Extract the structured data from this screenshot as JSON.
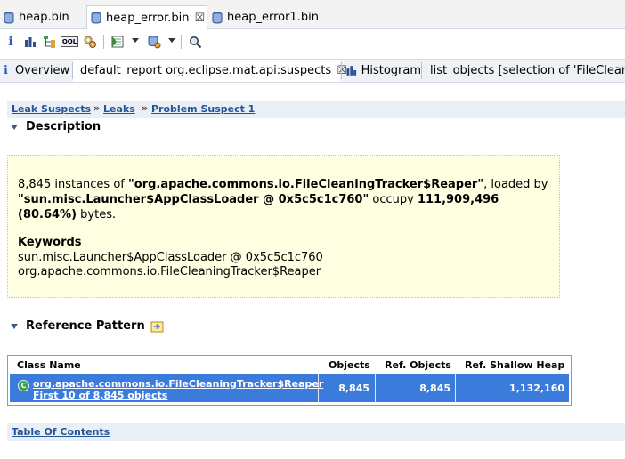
{
  "editor_tabs": [
    {
      "label": "heap.bin"
    },
    {
      "label": "heap_error.bin",
      "close": "☒"
    },
    {
      "label": "heap_error1.bin"
    }
  ],
  "view_tabs": [
    {
      "label": "Overview"
    },
    {
      "label": "default_report  org.eclipse.mat.api:suspects",
      "close": "☒"
    },
    {
      "label": "Histogram"
    },
    {
      "label": "list_objects  [selection of 'FileCleanin"
    }
  ],
  "toolbar": {
    "info_icon_text": "i",
    "oql_text": "OQL"
  },
  "breadcrumb": {
    "items": [
      "Leak Suspects",
      "Leaks",
      "Problem Suspect 1"
    ],
    "separator": "»"
  },
  "description": {
    "heading": "Description",
    "count": "8,845",
    "text_instances_of": " instances of ",
    "class_name": "\"org.apache.commons.io.FileCleaningTracker$Reaper\"",
    "text_loaded_by": ", loaded by ",
    "loader": "\"sun.misc.Launcher$AppClassLoader @ 0x5c5c1c760\"",
    "text_occupy": " occupy ",
    "bytes": "111,909,496 (80.64%)",
    "text_bytes": " bytes.",
    "keywords_heading": "Keywords",
    "keywords": [
      "sun.misc.Launcher$AppClassLoader @ 0x5c5c1c760",
      "org.apache.commons.io.FileCleaningTracker$Reaper"
    ]
  },
  "reference_pattern": {
    "heading": "Reference Pattern",
    "columns": [
      "Class Name",
      "Objects",
      "Ref. Objects",
      "Ref. Shallow Heap"
    ],
    "rows": [
      {
        "icon_letter": "C",
        "class_name": "org.apache.commons.io.FileCleaningTracker$Reaper",
        "sub_link": "First 10 of 8,845 objects",
        "objects": "8,845",
        "ref_objects": "8,845",
        "ref_shallow_heap": "1,132,160"
      }
    ]
  },
  "toc_link": "Table Of Contents",
  "colors": {
    "selection": "#3b7bdc",
    "link": "#225599",
    "note_bg": "#ffffe1",
    "crumb_bg": "#eaeef5"
  }
}
